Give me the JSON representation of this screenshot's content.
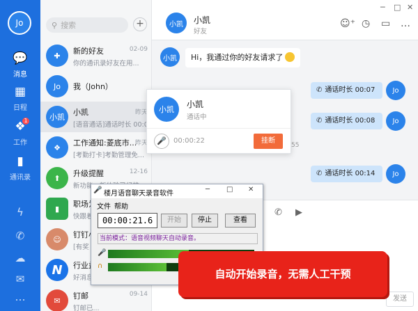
{
  "rail": {
    "me_label": "Jo",
    "nav": [
      {
        "label": "消息",
        "icon": "chat-icon"
      },
      {
        "label": "日程",
        "icon": "calendar-icon"
      },
      {
        "label": "工作",
        "icon": "apps-icon",
        "badge": "1"
      },
      {
        "label": "通讯录",
        "icon": "contacts-icon"
      }
    ],
    "tools": [
      "lightning-icon",
      "phone-icon",
      "cloud-icon",
      "mail-icon",
      "more-icon"
    ]
  },
  "list": {
    "search_placeholder": "搜索",
    "add_label": "+",
    "items": [
      {
        "name": "新的好友",
        "preview": "你的通讯录好友在用...",
        "time": "02-09",
        "avatar_text": "",
        "avatar_color": "#2b83ea",
        "icon": "add-user-icon"
      },
      {
        "name": "我（John）",
        "preview": "",
        "time": "",
        "avatar_text": "Jo",
        "avatar_color": "#2b83ea"
      },
      {
        "name": "小凯",
        "preview": "[语音通话]通话时长 00:0...",
        "time": "昨天",
        "avatar_text": "小凯",
        "avatar_color": "#2b83ea"
      },
      {
        "name": "工作通知:菱底市...",
        "preview": "[考勤打卡]考勤管理免...",
        "time": "昨天",
        "avatar_text": "",
        "avatar_color": "#2b83ea",
        "icon": "grid-icon"
      },
      {
        "name": "升级提醒",
        "preview": "新功能，新体验已经推...",
        "time": "12-16",
        "avatar_text": "",
        "avatar_color": "#3bb54a",
        "icon": "upgrade-icon"
      },
      {
        "name": "职场为",
        "preview": "快跟着",
        "time": "",
        "avatar_text": "",
        "avatar_color": "#2fa84f",
        "icon": "battery-icon"
      },
      {
        "name": "钉钉小",
        "preview": "[有奖",
        "time": "",
        "avatar_text": "",
        "avatar_color": "#d88a6a",
        "icon": "person-icon"
      },
      {
        "name": "行业益",
        "preview": "好消息",
        "time": "",
        "avatar_text": "N",
        "avatar_color": "#1a73e8"
      },
      {
        "name": "钉邮",
        "preview": "钉邮已...",
        "time": "09-14",
        "avatar_text": "",
        "avatar_color": "#e24a3b",
        "icon": "mail-icon"
      }
    ]
  },
  "chat": {
    "name": "小凯",
    "subtitle": "好友",
    "avatar_text": "小凯",
    "incoming_text": "Hi，我通过你的好友请求了",
    "incoming_avatar": "小凯",
    "outgoing": [
      {
        "text": "通话时长 00:07"
      },
      {
        "text": "通话时长 00:08"
      },
      {
        "text": "通话时长 00:14"
      }
    ],
    "out_avatar": "Jo",
    "timestamp": ":55",
    "send_label": "发送"
  },
  "call_popup": {
    "avatar_text": "小凯",
    "name": "小凯",
    "status": "通话中",
    "timer": "00:00:22",
    "hangup_label": "挂断"
  },
  "recorder": {
    "title": "楼月语音聊天录音软件",
    "menu": [
      "文件",
      "帮助"
    ],
    "time": "00:00:21.6",
    "buttons": {
      "start": "开始",
      "stop": "停止",
      "view": "查看"
    },
    "mode_text": "当前模式：语音视频聊天自动录音。",
    "level_mic": 0.55,
    "level_speaker": 0.4
  },
  "callout": {
    "text": "自动开始录音，无需人工干预"
  }
}
